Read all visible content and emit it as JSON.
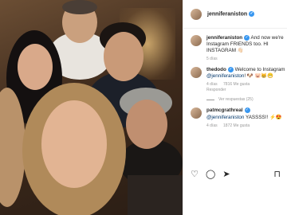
{
  "post": {
    "username": "jenniferaniston",
    "verified_mark": "✓"
  },
  "comments": [
    {
      "username": "jenniferaniston",
      "text": "And now we're Instagram FRIENDS too. HI INSTAGRAM 👋🏻",
      "time": "5 días"
    },
    {
      "username": "thedodo",
      "text_before": "Welcome to Instagram ",
      "mention": "@jenniferaniston",
      "text_after": "! 🐶 🐷😸😁",
      "time": "4 días",
      "likes": "7816 Me gusta",
      "reply": "Responder",
      "view_replies": "Ver respuestas (25)"
    },
    {
      "username": "patmcgrathreal",
      "mention": "@jenniferaniston",
      "text_after": " YASSSS!! ⚡😍",
      "time": "4 días",
      "likes": "1872 Me gusta"
    }
  ],
  "actions": {
    "like_icon": "♡",
    "comment_icon": "◯",
    "share_icon": "➤",
    "bookmark_icon": "⊓"
  },
  "colors": {
    "verified": "#3897f0",
    "mention": "#003569",
    "meta_gray": "#999999"
  }
}
